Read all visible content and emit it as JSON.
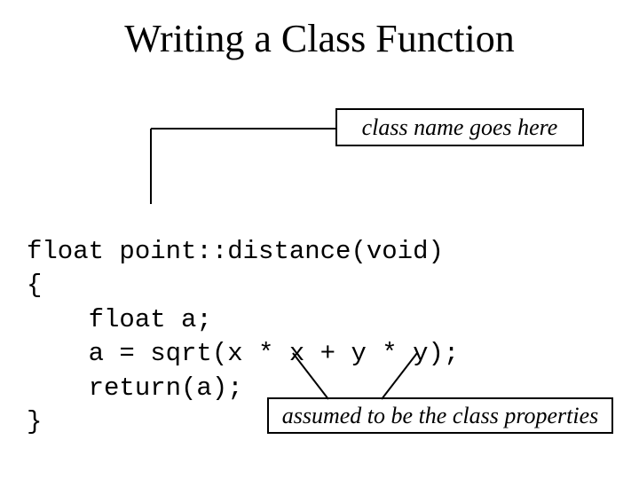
{
  "title": "Writing a Class Function",
  "annot_top": "class name goes here",
  "annot_bottom": "assumed to be the class properties",
  "code": {
    "l1": "float point::distance(void)",
    "l2": "{",
    "l3": "    float a;",
    "l4": "    a = sqrt(x * x + y * y);",
    "l5": "    return(a);",
    "l6": "}"
  }
}
